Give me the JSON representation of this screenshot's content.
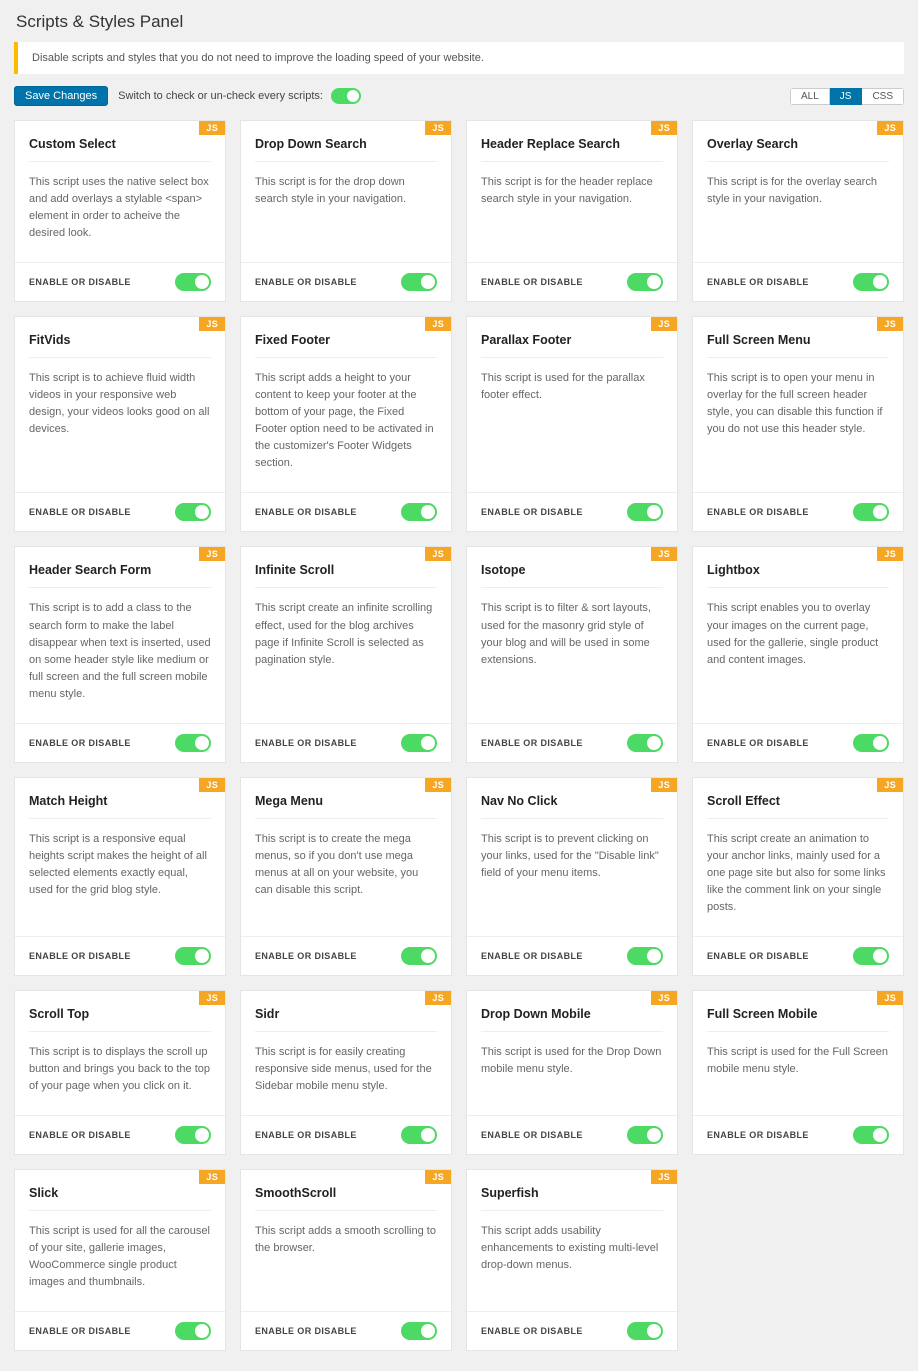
{
  "header": {
    "title": "Scripts & Styles Panel",
    "notice": "Disable scripts and styles that you do not need to improve the loading speed of your website."
  },
  "toolbar": {
    "save_label": "Save Changes",
    "switch_label": "Switch to check or un-check every scripts:",
    "filters": {
      "all": "ALL",
      "js": "JS",
      "css": "CSS"
    },
    "active_filter": "JS"
  },
  "card_footer_label": "ENABLE OR DISABLE",
  "badge_label": "JS",
  "cards": [
    {
      "title": "Custom Select",
      "desc": "This script uses the native select box and add overlays a stylable <span> element in order to acheive the desired look."
    },
    {
      "title": "Drop Down Search",
      "desc": "This script is for the drop down search style in your navigation."
    },
    {
      "title": "Header Replace Search",
      "desc": "This script is for the header replace search style in your navigation."
    },
    {
      "title": "Overlay Search",
      "desc": "This script is for the overlay search style in your navigation."
    },
    {
      "title": "FitVids",
      "desc": "This script is to achieve fluid width videos in your responsive web design, your videos looks good on all devices."
    },
    {
      "title": "Fixed Footer",
      "desc": "This script adds a height to your content to keep your footer at the bottom of your page, the Fixed Footer option need to be activated in the customizer's Footer Widgets section."
    },
    {
      "title": "Parallax Footer",
      "desc": "This script is used for the parallax footer effect."
    },
    {
      "title": "Full Screen Menu",
      "desc": "This script is to open your menu in overlay for the full screen header style, you can disable this function if you do not use this header style."
    },
    {
      "title": "Header Search Form",
      "desc": "This script is to add a class to the search form to make the label disappear when text is inserted, used on some header style like medium or full screen and the full screen mobile menu style."
    },
    {
      "title": "Infinite Scroll",
      "desc": "This script create an infinite scrolling effect, used for the blog archives page if Infinite Scroll is selected as pagination style."
    },
    {
      "title": "Isotope",
      "desc": "This script is to filter & sort layouts, used for the masonry grid style of your blog and will be used in some extensions."
    },
    {
      "title": "Lightbox",
      "desc": "This script enables you to overlay your images on the current page, used for the gallerie, single product and content images."
    },
    {
      "title": "Match Height",
      "desc": "This script is a responsive equal heights script makes the height of all selected elements exactly equal, used for the grid blog style."
    },
    {
      "title": "Mega Menu",
      "desc": "This script is to create the mega menus, so if you don't use mega menus at all on your website, you can disable this script."
    },
    {
      "title": "Nav No Click",
      "desc": "This script is to prevent clicking on your links, used for the \"Disable link\" field of your menu items."
    },
    {
      "title": "Scroll Effect",
      "desc": "This script create an animation to your anchor links, mainly used for a one page site but also for some links like the comment link on your single posts."
    },
    {
      "title": "Scroll Top",
      "desc": "This script is to displays the scroll up button and brings you back to the top of your page when you click on it."
    },
    {
      "title": "Sidr",
      "desc": "This script is for easily creating responsive side menus, used for the Sidebar mobile menu style."
    },
    {
      "title": "Drop Down Mobile",
      "desc": "This script is used for the Drop Down mobile menu style."
    },
    {
      "title": "Full Screen Mobile",
      "desc": "This script is used for the Full Screen mobile menu style."
    },
    {
      "title": "Slick",
      "desc": "This script is used for all the carousel of your site, gallerie images, WooCommerce single product images and thumbnails."
    },
    {
      "title": "SmoothScroll",
      "desc": "This script adds a smooth scrolling to the browser."
    },
    {
      "title": "Superfish",
      "desc": "This script adds usability enhancements to existing multi-level drop-down menus."
    }
  ]
}
